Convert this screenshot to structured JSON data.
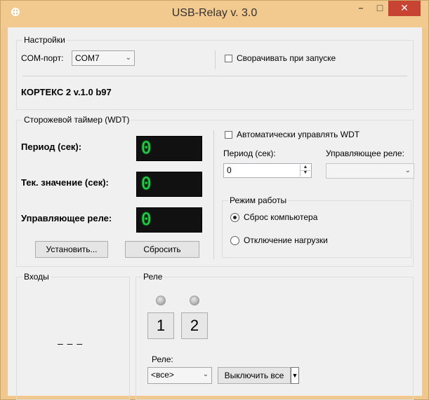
{
  "window": {
    "title": "USB-Relay v. 3.0",
    "minimize_glyph": "–",
    "maximize_glyph": "□",
    "close_glyph": "✕"
  },
  "settings": {
    "legend": "Настройки",
    "com_port_label": "COM-порт:",
    "com_port_value": "COM7",
    "minimize_on_start_label": "Сворачивать при запуске",
    "minimize_on_start_checked": false,
    "device_version": "КОРТЕКС 2 v.1.0 b97"
  },
  "wdt": {
    "legend": "Сторожевой таймер (WDT)",
    "period_label": "Период (сек):",
    "period_display": "0",
    "current_value_label": "Тек. значение (сек):",
    "current_value_display": "0",
    "control_relay_label": "Управляющее реле:",
    "control_relay_display": "0",
    "set_button": "Установить...",
    "reset_button": "Сбросить",
    "auto_control_label": "Автоматически управлять WDT",
    "auto_control_checked": false,
    "period_input_label": "Период (сек):",
    "period_input_value": "0",
    "control_relay_select_label": "Управляющее реле:",
    "control_relay_select_value": "",
    "mode_legend": "Режим работы",
    "mode_reset_label": "Сброс компьютера",
    "mode_load_off_label": "Отключение нагрузки",
    "selected_mode": "Сброс компьютера"
  },
  "inputs": {
    "legend": "Входы",
    "value": "– – –"
  },
  "relay": {
    "legend": "Реле",
    "items": [
      {
        "label": "1",
        "led_state": "off"
      },
      {
        "label": "2",
        "led_state": "off"
      }
    ],
    "select_label": "Реле:",
    "select_value": "<все>",
    "off_all_button": "Выключить все"
  },
  "colors": {
    "title_bar": "#f2c98f",
    "close_button": "#c84432",
    "lcd_digit": "#22d244",
    "lcd_background": "#111111"
  },
  "icons": {
    "app_icon": "crosshair-circle-icon",
    "combo_arrow": "chevron-down-icon",
    "spin_up": "triangle-up-icon",
    "spin_down": "triangle-down-icon",
    "dropdown_arrow": "triangle-down-icon"
  }
}
